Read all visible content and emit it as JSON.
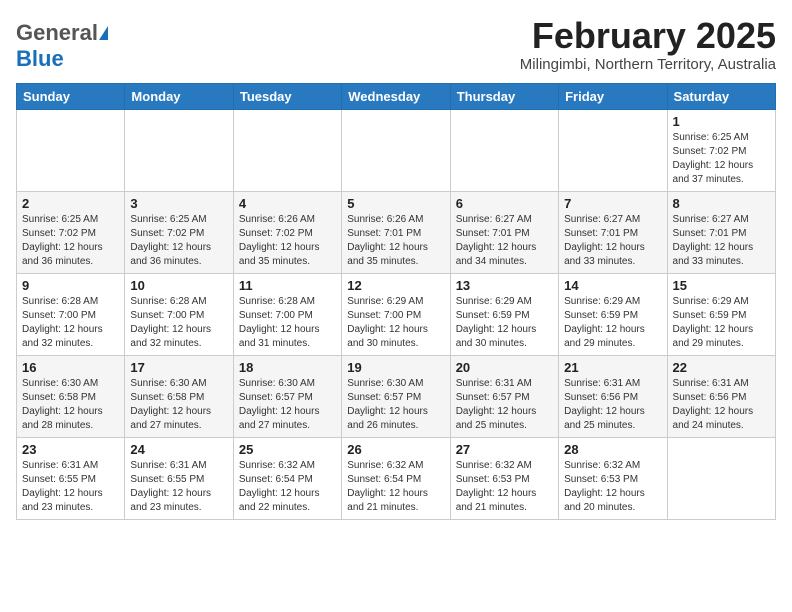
{
  "header": {
    "logo_general": "General",
    "logo_blue": "Blue",
    "month_title": "February 2025",
    "location": "Milingimbi, Northern Territory, Australia"
  },
  "weekdays": [
    "Sunday",
    "Monday",
    "Tuesday",
    "Wednesday",
    "Thursday",
    "Friday",
    "Saturday"
  ],
  "weeks": [
    [
      {
        "day": "",
        "info": ""
      },
      {
        "day": "",
        "info": ""
      },
      {
        "day": "",
        "info": ""
      },
      {
        "day": "",
        "info": ""
      },
      {
        "day": "",
        "info": ""
      },
      {
        "day": "",
        "info": ""
      },
      {
        "day": "1",
        "info": "Sunrise: 6:25 AM\nSunset: 7:02 PM\nDaylight: 12 hours\nand 37 minutes."
      }
    ],
    [
      {
        "day": "2",
        "info": "Sunrise: 6:25 AM\nSunset: 7:02 PM\nDaylight: 12 hours\nand 36 minutes."
      },
      {
        "day": "3",
        "info": "Sunrise: 6:25 AM\nSunset: 7:02 PM\nDaylight: 12 hours\nand 36 minutes."
      },
      {
        "day": "4",
        "info": "Sunrise: 6:26 AM\nSunset: 7:02 PM\nDaylight: 12 hours\nand 35 minutes."
      },
      {
        "day": "5",
        "info": "Sunrise: 6:26 AM\nSunset: 7:01 PM\nDaylight: 12 hours\nand 35 minutes."
      },
      {
        "day": "6",
        "info": "Sunrise: 6:27 AM\nSunset: 7:01 PM\nDaylight: 12 hours\nand 34 minutes."
      },
      {
        "day": "7",
        "info": "Sunrise: 6:27 AM\nSunset: 7:01 PM\nDaylight: 12 hours\nand 33 minutes."
      },
      {
        "day": "8",
        "info": "Sunrise: 6:27 AM\nSunset: 7:01 PM\nDaylight: 12 hours\nand 33 minutes."
      }
    ],
    [
      {
        "day": "9",
        "info": "Sunrise: 6:28 AM\nSunset: 7:00 PM\nDaylight: 12 hours\nand 32 minutes."
      },
      {
        "day": "10",
        "info": "Sunrise: 6:28 AM\nSunset: 7:00 PM\nDaylight: 12 hours\nand 32 minutes."
      },
      {
        "day": "11",
        "info": "Sunrise: 6:28 AM\nSunset: 7:00 PM\nDaylight: 12 hours\nand 31 minutes."
      },
      {
        "day": "12",
        "info": "Sunrise: 6:29 AM\nSunset: 7:00 PM\nDaylight: 12 hours\nand 30 minutes."
      },
      {
        "day": "13",
        "info": "Sunrise: 6:29 AM\nSunset: 6:59 PM\nDaylight: 12 hours\nand 30 minutes."
      },
      {
        "day": "14",
        "info": "Sunrise: 6:29 AM\nSunset: 6:59 PM\nDaylight: 12 hours\nand 29 minutes."
      },
      {
        "day": "15",
        "info": "Sunrise: 6:29 AM\nSunset: 6:59 PM\nDaylight: 12 hours\nand 29 minutes."
      }
    ],
    [
      {
        "day": "16",
        "info": "Sunrise: 6:30 AM\nSunset: 6:58 PM\nDaylight: 12 hours\nand 28 minutes."
      },
      {
        "day": "17",
        "info": "Sunrise: 6:30 AM\nSunset: 6:58 PM\nDaylight: 12 hours\nand 27 minutes."
      },
      {
        "day": "18",
        "info": "Sunrise: 6:30 AM\nSunset: 6:57 PM\nDaylight: 12 hours\nand 27 minutes."
      },
      {
        "day": "19",
        "info": "Sunrise: 6:30 AM\nSunset: 6:57 PM\nDaylight: 12 hours\nand 26 minutes."
      },
      {
        "day": "20",
        "info": "Sunrise: 6:31 AM\nSunset: 6:57 PM\nDaylight: 12 hours\nand 25 minutes."
      },
      {
        "day": "21",
        "info": "Sunrise: 6:31 AM\nSunset: 6:56 PM\nDaylight: 12 hours\nand 25 minutes."
      },
      {
        "day": "22",
        "info": "Sunrise: 6:31 AM\nSunset: 6:56 PM\nDaylight: 12 hours\nand 24 minutes."
      }
    ],
    [
      {
        "day": "23",
        "info": "Sunrise: 6:31 AM\nSunset: 6:55 PM\nDaylight: 12 hours\nand 23 minutes."
      },
      {
        "day": "24",
        "info": "Sunrise: 6:31 AM\nSunset: 6:55 PM\nDaylight: 12 hours\nand 23 minutes."
      },
      {
        "day": "25",
        "info": "Sunrise: 6:32 AM\nSunset: 6:54 PM\nDaylight: 12 hours\nand 22 minutes."
      },
      {
        "day": "26",
        "info": "Sunrise: 6:32 AM\nSunset: 6:54 PM\nDaylight: 12 hours\nand 21 minutes."
      },
      {
        "day": "27",
        "info": "Sunrise: 6:32 AM\nSunset: 6:53 PM\nDaylight: 12 hours\nand 21 minutes."
      },
      {
        "day": "28",
        "info": "Sunrise: 6:32 AM\nSunset: 6:53 PM\nDaylight: 12 hours\nand 20 minutes."
      },
      {
        "day": "",
        "info": ""
      }
    ]
  ]
}
